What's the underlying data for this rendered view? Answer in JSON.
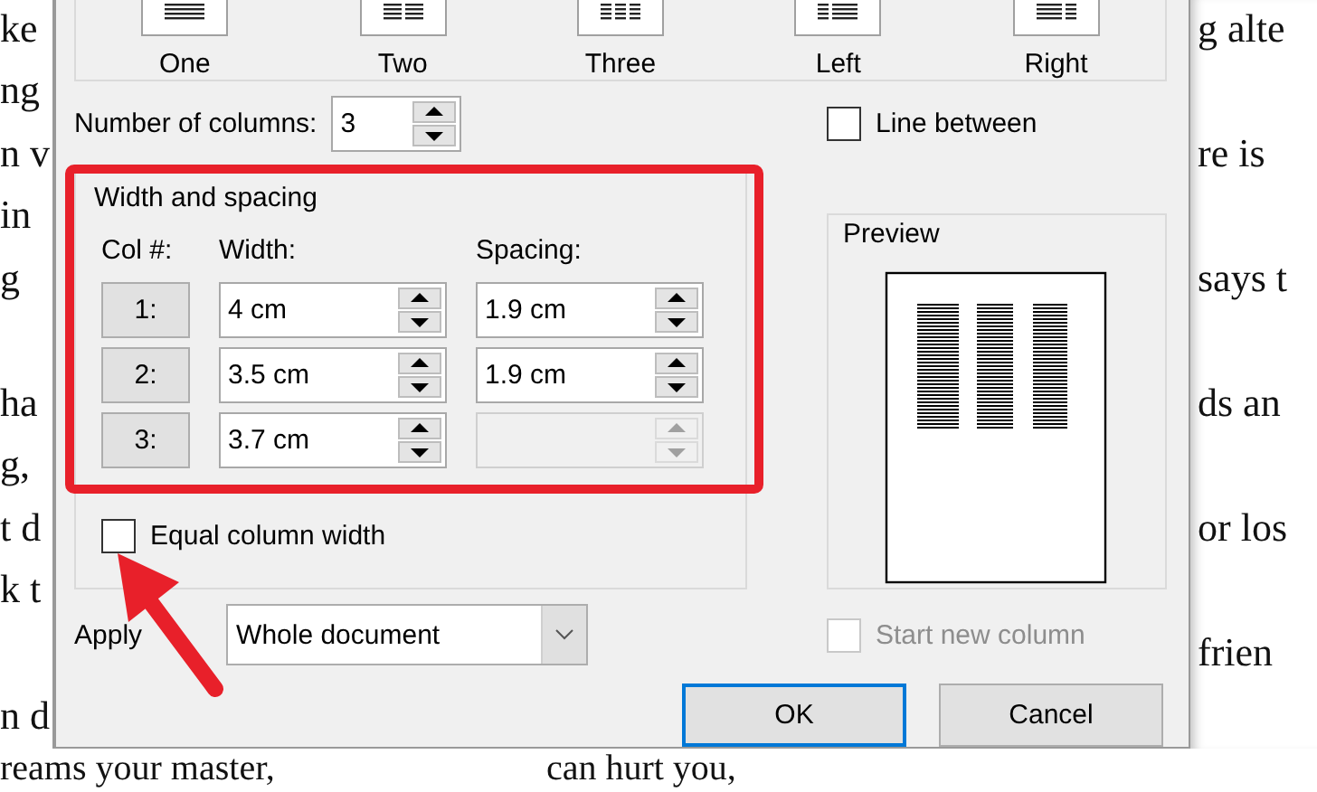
{
  "document": {
    "left_edge": [
      {
        "text": "ke",
        "paragraph_start": false
      },
      {
        "text": "ng",
        "paragraph_start": false
      },
      {
        "text": "n v",
        "paragraph_start": false
      },
      {
        "text": "in",
        "paragraph_start": false
      },
      {
        "text": "g",
        "paragraph_start": false
      },
      {
        "text": "ha",
        "paragraph_start": true
      },
      {
        "text": "g,",
        "paragraph_start": false
      },
      {
        "text": "t d",
        "paragraph_start": false
      },
      {
        "text": "k t",
        "paragraph_start": false
      },
      {
        "text": "n d",
        "paragraph_start": true
      }
    ],
    "right_edge": [
      "g alte",
      "re is",
      "says t",
      "ds an",
      "or los",
      "frien"
    ],
    "bottom": [
      "reams your master,",
      "can hurt you,"
    ]
  },
  "presets": [
    {
      "label": "One",
      "kind": "one"
    },
    {
      "label": "Two",
      "kind": "two"
    },
    {
      "label": "Three",
      "kind": "three"
    },
    {
      "label": "Left",
      "kind": "left"
    },
    {
      "label": "Right",
      "kind": "right"
    }
  ],
  "number_of_columns": {
    "label": "Number of columns:",
    "value": "3"
  },
  "line_between": {
    "label": "Line between",
    "checked": false
  },
  "width_and_spacing": {
    "title": "Width and spacing",
    "headers": [
      "Col #:",
      "Width:",
      "Spacing:"
    ],
    "rows": [
      {
        "col": "1:",
        "width": "4 cm",
        "spacing": "1.9 cm",
        "spacing_disabled": false
      },
      {
        "col": "2:",
        "width": "3.5 cm",
        "spacing": "1.9 cm",
        "spacing_disabled": false
      },
      {
        "col": "3:",
        "width": "3.7 cm",
        "spacing_disabled": true
      }
    ]
  },
  "equal_column_width": {
    "label": "Equal column width",
    "checked": false
  },
  "preview": {
    "title": "Preview"
  },
  "apply_to": {
    "label": "Apply",
    "value": "Whole document"
  },
  "start_new_column": {
    "label": "Start new column",
    "checked": false,
    "disabled": true
  },
  "buttons": [
    {
      "label": "OK",
      "focused": true
    },
    {
      "label": "Cancel",
      "focused": false
    }
  ]
}
